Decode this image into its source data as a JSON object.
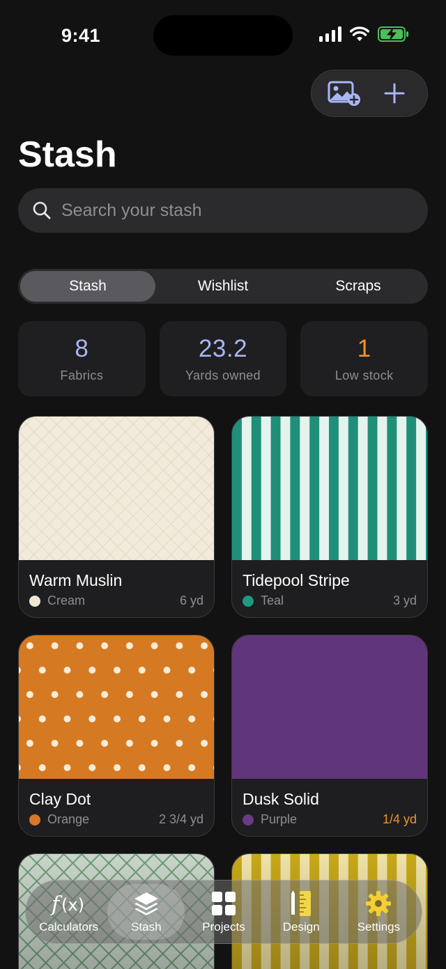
{
  "status_bar": {
    "time": "9:41"
  },
  "header": {
    "title": "Stash"
  },
  "search": {
    "placeholder": "Search your stash"
  },
  "segments": [
    {
      "label": "Stash",
      "active": true
    },
    {
      "label": "Wishlist",
      "active": false
    },
    {
      "label": "Scraps",
      "active": false
    }
  ],
  "stats": [
    {
      "value": "8",
      "label": "Fabrics",
      "color": "#a9b6f5"
    },
    {
      "value": "23.2",
      "label": "Yards owned",
      "color": "#a9b6f5"
    },
    {
      "value": "1",
      "label": "Low stock",
      "color": "#f0932b"
    }
  ],
  "fabrics": [
    {
      "name": "Warm Muslin",
      "color_name": "Cream",
      "yardage": "6 yd",
      "dot_color": "#efe6d2",
      "pattern": "crosshatch",
      "low_stock": false
    },
    {
      "name": "Tidepool Stripe",
      "color_name": "Teal",
      "yardage": "3 yd",
      "dot_color": "#1f9a80",
      "pattern": "stripe",
      "low_stock": false
    },
    {
      "name": "Clay Dot",
      "color_name": "Orange",
      "yardage": "2 3/4 yd",
      "dot_color": "#d8782a",
      "pattern": "dots",
      "low_stock": false
    },
    {
      "name": "Dusk Solid",
      "color_name": "Purple",
      "yardage": "1/4 yd",
      "dot_color": "#6a3a86",
      "pattern": "solid",
      "low_stock": true,
      "yardage_color": "#f0932b"
    }
  ],
  "tab_bar": [
    {
      "label": "Calculators",
      "icon": "function-icon",
      "active": false
    },
    {
      "label": "Stash",
      "icon": "layers-icon",
      "active": true
    },
    {
      "label": "Projects",
      "icon": "grid-icon",
      "active": false
    },
    {
      "label": "Design",
      "icon": "pencil-ruler-icon",
      "active": false
    },
    {
      "label": "Settings",
      "icon": "gear-icon",
      "active": false
    }
  ],
  "colors": {
    "accent": "#a9b6f5",
    "warning": "#f0932b",
    "background": "#121212"
  }
}
